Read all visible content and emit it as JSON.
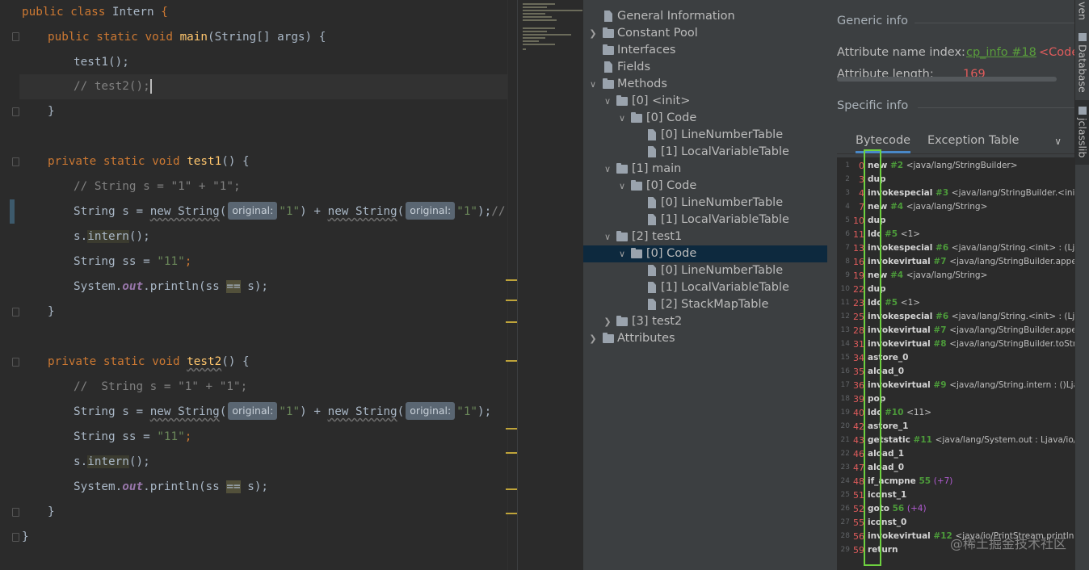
{
  "editor": {
    "lines": {
      "l1": [
        "public",
        "class",
        "Intern",
        "{"
      ],
      "l2": [
        "public",
        "static",
        "void",
        "main",
        "(",
        "String",
        "[] args",
        ") {"
      ],
      "l3": [
        "test1",
        "();"
      ],
      "l4": [
        "// test2();"
      ],
      "l5": [
        "}"
      ],
      "l6": [
        "private",
        "static",
        "void",
        "test1",
        "() {"
      ],
      "l7": [
        "// String s = \"1\" + \"1\";"
      ],
      "l8": [
        "String",
        "s",
        "=",
        "new String",
        "(",
        "original:",
        "\"1\"",
        ") + ",
        "new String",
        "(",
        "original:",
        "\"1\"",
        ");",
        "// 不在常"
      ],
      "l9": [
        "s",
        ".",
        "intern",
        "();"
      ],
      "l10": [
        "String",
        "ss",
        "=",
        "\"11\"",
        ";"
      ],
      "l11": [
        "System",
        ".",
        "out",
        ".println(ss",
        "==",
        "s);"
      ],
      "l12": [
        "}"
      ],
      "l13": [
        "private",
        "static",
        "void",
        "test2",
        "() {"
      ],
      "l14": [
        "//  String s = \"1\" + \"1\";"
      ],
      "l15": [
        "String",
        "s",
        "=",
        "new String",
        "(",
        "original:",
        "\"1\"",
        ") + ",
        "new String",
        "(",
        "original:",
        "\"1\"",
        ");"
      ],
      "l16": [
        "String",
        "ss",
        "=",
        "\"11\"",
        ";"
      ],
      "l17": [
        "s",
        ".",
        "intern",
        "();"
      ],
      "l18": [
        "System",
        ".",
        "out",
        ".println(ss",
        "==",
        "s);"
      ],
      "l19": [
        "}"
      ],
      "l20": [
        "}"
      ]
    }
  },
  "tree": {
    "items": [
      {
        "label": "General Information"
      },
      {
        "label": "Constant Pool"
      },
      {
        "label": "Interfaces"
      },
      {
        "label": "Fields"
      },
      {
        "label": "Methods"
      },
      {
        "label": "[0] <init>"
      },
      {
        "label": "[0] Code"
      },
      {
        "label": "[0] LineNumberTable"
      },
      {
        "label": "[1] LocalVariableTable"
      },
      {
        "label": "[1] main"
      },
      {
        "label": "[0] Code"
      },
      {
        "label": "[0] LineNumberTable"
      },
      {
        "label": "[1] LocalVariableTable"
      },
      {
        "label": "[2] test1"
      },
      {
        "label": "[0] Code"
      },
      {
        "label": "[0] LineNumberTable"
      },
      {
        "label": "[1] LocalVariableTable"
      },
      {
        "label": "[2] StackMapTable"
      },
      {
        "label": "[3] test2"
      },
      {
        "label": "Attributes"
      }
    ]
  },
  "info": {
    "generic_header": "Generic info",
    "attr_name_key": "Attribute name index:",
    "attr_name_link": "cp_info #18",
    "attr_name_value": "<Code>",
    "attr_length_key": "Attribute length:",
    "attr_length_value": "169",
    "specific_header": "Specific info",
    "tabs": [
      "Bytecode",
      "Exception Table"
    ],
    "bytecode": [
      {
        "ln": "1",
        "off": "0",
        "op": "new",
        "ref": "#2",
        "arg": "<java/lang/StringBuilder>"
      },
      {
        "ln": "2",
        "off": "3",
        "op": "dup",
        "ref": "",
        "arg": ""
      },
      {
        "ln": "3",
        "off": "4",
        "op": "invokespecial",
        "ref": "#3",
        "arg": "<java/lang/StringBuilder.<init> :"
      },
      {
        "ln": "4",
        "off": "7",
        "op": "new",
        "ref": "#4",
        "arg": "<java/lang/String>"
      },
      {
        "ln": "5",
        "off": "10",
        "op": "dup",
        "ref": "",
        "arg": ""
      },
      {
        "ln": "6",
        "off": "11",
        "op": "ldc",
        "ref": "#5",
        "arg": "<1>"
      },
      {
        "ln": "7",
        "off": "13",
        "op": "invokespecial",
        "ref": "#6",
        "arg": "<java/lang/String.<init> : (Ljava"
      },
      {
        "ln": "8",
        "off": "16",
        "op": "invokevirtual",
        "ref": "#7",
        "arg": "<java/lang/StringBuilder.append"
      },
      {
        "ln": "9",
        "off": "19",
        "op": "new",
        "ref": "#4",
        "arg": "<java/lang/String>"
      },
      {
        "ln": "10",
        "off": "22",
        "op": "dup",
        "ref": "",
        "arg": ""
      },
      {
        "ln": "11",
        "off": "23",
        "op": "ldc",
        "ref": "#5",
        "arg": "<1>"
      },
      {
        "ln": "12",
        "off": "25",
        "op": "invokespecial",
        "ref": "#6",
        "arg": "<java/lang/String.<init> : (Ljava"
      },
      {
        "ln": "13",
        "off": "28",
        "op": "invokevirtual",
        "ref": "#7",
        "arg": "<java/lang/StringBuilder.append"
      },
      {
        "ln": "14",
        "off": "31",
        "op": "invokevirtual",
        "ref": "#8",
        "arg": "<java/lang/StringBuilder.toStrin"
      },
      {
        "ln": "15",
        "off": "34",
        "op": "astore_0",
        "ref": "",
        "arg": ""
      },
      {
        "ln": "16",
        "off": "35",
        "op": "aload_0",
        "ref": "",
        "arg": ""
      },
      {
        "ln": "17",
        "off": "36",
        "op": "invokevirtual",
        "ref": "#9",
        "arg": "<java/lang/String.intern : ()Ljav"
      },
      {
        "ln": "18",
        "off": "39",
        "op": "pop",
        "ref": "",
        "arg": ""
      },
      {
        "ln": "19",
        "off": "40",
        "op": "ldc",
        "ref": "#10",
        "arg": "<11>"
      },
      {
        "ln": "20",
        "off": "42",
        "op": "astore_1",
        "ref": "",
        "arg": ""
      },
      {
        "ln": "21",
        "off": "43",
        "op": "getstatic",
        "ref": "#11",
        "arg": "<java/lang/System.out : Ljava/io/P"
      },
      {
        "ln": "22",
        "off": "46",
        "op": "aload_1",
        "ref": "",
        "arg": ""
      },
      {
        "ln": "23",
        "off": "47",
        "op": "aload_0",
        "ref": "",
        "arg": ""
      },
      {
        "ln": "24",
        "off": "48",
        "op": "if_acmpne",
        "ref": "55",
        "arg": "(+7)"
      },
      {
        "ln": "25",
        "off": "51",
        "op": "iconst_1",
        "ref": "",
        "arg": ""
      },
      {
        "ln": "26",
        "off": "52",
        "op": "goto",
        "ref": "56",
        "arg": "(+4)"
      },
      {
        "ln": "27",
        "off": "55",
        "op": "iconst_0",
        "ref": "",
        "arg": ""
      },
      {
        "ln": "28",
        "off": "56",
        "op": "invokevirtual",
        "ref": "#12",
        "arg": "<java/io/PrintStream.println : ("
      },
      {
        "ln": "29",
        "off": "59",
        "op": "return",
        "ref": "",
        "arg": ""
      }
    ],
    "watermark": "@稀土掘金技术社区"
  },
  "sidestrip": {
    "tabs": [
      "ven",
      "Database",
      "jclasslib"
    ]
  },
  "colors": {
    "editor_bg": "#2b2b2b",
    "panel_bg": "#3c3f41",
    "keyword": "#cc7832",
    "method": "#ffc66d",
    "string": "#6a8759",
    "selection": "#0d293e",
    "offset": "#e05c5c",
    "highlight_box": "#6ed140"
  }
}
